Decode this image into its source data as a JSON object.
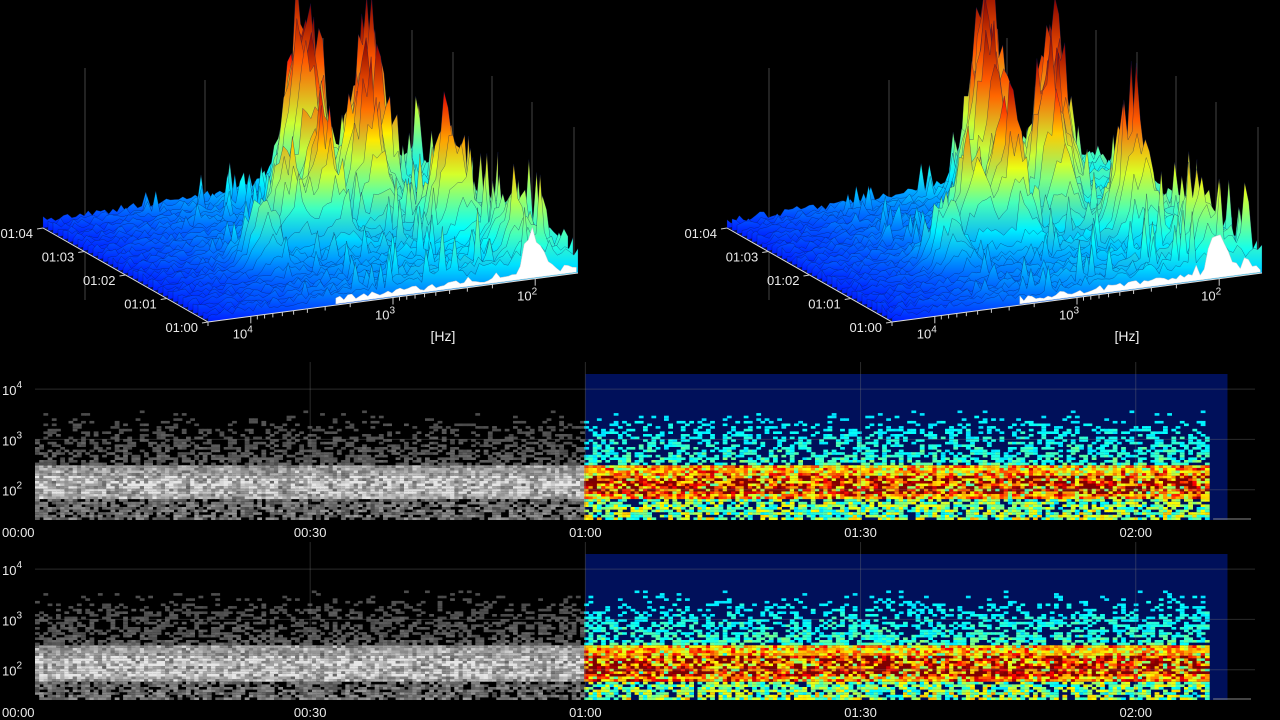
{
  "chart_data": [
    {
      "type": "surface3d",
      "panel": "top-left",
      "color_scale": "jet",
      "x_axis": {
        "label": "[Hz]",
        "scale": "log",
        "ticks": [
          {
            "value": 10000,
            "base": "10",
            "exp": "4"
          },
          {
            "value": 1000,
            "base": "10",
            "exp": "3"
          },
          {
            "value": 100,
            "base": "10",
            "exp": "2"
          }
        ]
      },
      "y_axis": {
        "label": "",
        "ticks": [
          "01:00",
          "01:01",
          "01:02",
          "01:03",
          "01:04"
        ]
      },
      "peaks": [
        {
          "hz": 100,
          "time": "01:00.5",
          "height": 0.25
        },
        {
          "hz": 150,
          "time": "01:01.5",
          "height": 0.55
        },
        {
          "hz": 200,
          "time": "01:03.0",
          "height": 0.9
        },
        {
          "hz": 300,
          "time": "01:02.5",
          "height": 0.7
        },
        {
          "hz": 400,
          "time": "01:03.5",
          "height": 1.0
        },
        {
          "hz": 600,
          "time": "01:03.0",
          "height": 0.85
        },
        {
          "hz": 800,
          "time": "01:02.0",
          "height": 0.6
        },
        {
          "hz": 1500,
          "time": "01:02.0",
          "height": 0.45
        },
        {
          "hz": 3000,
          "time": "01:01.5",
          "height": 0.3
        }
      ]
    },
    {
      "type": "surface3d",
      "panel": "top-right",
      "color_scale": "jet",
      "x_axis": {
        "label": "[Hz]",
        "scale": "log",
        "ticks": [
          {
            "value": 10000,
            "base": "10",
            "exp": "4"
          },
          {
            "value": 1000,
            "base": "10",
            "exp": "3"
          },
          {
            "value": 100,
            "base": "10",
            "exp": "2"
          }
        ]
      },
      "y_axis": {
        "label": "",
        "ticks": [
          "01:00",
          "01:01",
          "01:02",
          "01:03",
          "01:04"
        ]
      },
      "peaks": [
        {
          "hz": 100,
          "time": "01:00.5",
          "height": 0.3
        },
        {
          "hz": 150,
          "time": "01:01.5",
          "height": 0.6
        },
        {
          "hz": 200,
          "time": "01:03.0",
          "height": 0.85
        },
        {
          "hz": 300,
          "time": "01:02.5",
          "height": 0.75
        },
        {
          "hz": 400,
          "time": "01:03.5",
          "height": 1.0
        },
        {
          "hz": 600,
          "time": "01:03.0",
          "height": 0.9
        },
        {
          "hz": 800,
          "time": "01:02.0",
          "height": 0.65
        },
        {
          "hz": 1500,
          "time": "01:02.0",
          "height": 0.5
        },
        {
          "hz": 3000,
          "time": "01:01.5",
          "height": 0.3
        }
      ]
    },
    {
      "type": "heatmap",
      "panel": "middle",
      "style": "spectrogram",
      "x_axis": {
        "ticks": [
          "00:00",
          "00:30",
          "01:00",
          "01:30",
          "02:00"
        ],
        "tick_seconds": [
          0,
          30,
          60,
          90,
          120
        ],
        "xlim": [
          0,
          133
        ]
      },
      "y_axis": {
        "scale": "log",
        "ylim": [
          25,
          20000
        ],
        "ticks": [
          {
            "value": 10000,
            "base": "10",
            "exp": "4"
          },
          {
            "value": 1000,
            "base": "10",
            "exp": "3"
          },
          {
            "value": 100,
            "base": "10",
            "exp": "2"
          }
        ]
      },
      "grayscale_until_seconds": 60,
      "colored_until_seconds": 128,
      "dominant_band_hz": [
        80,
        200
      ]
    },
    {
      "type": "heatmap",
      "panel": "bottom",
      "style": "spectrogram",
      "x_axis": {
        "ticks": [
          "00:00",
          "00:30",
          "01:00",
          "01:30",
          "02:00"
        ],
        "tick_seconds": [
          0,
          30,
          60,
          90,
          120
        ],
        "xlim": [
          0,
          133
        ]
      },
      "y_axis": {
        "scale": "log",
        "ylim": [
          25,
          20000
        ],
        "ticks": [
          {
            "value": 10000,
            "base": "10",
            "exp": "4"
          },
          {
            "value": 1000,
            "base": "10",
            "exp": "3"
          },
          {
            "value": 100,
            "base": "10",
            "exp": "2"
          }
        ]
      },
      "grayscale_until_seconds": 60,
      "colored_until_seconds": 128,
      "dominant_band_hz": [
        70,
        200
      ]
    }
  ]
}
